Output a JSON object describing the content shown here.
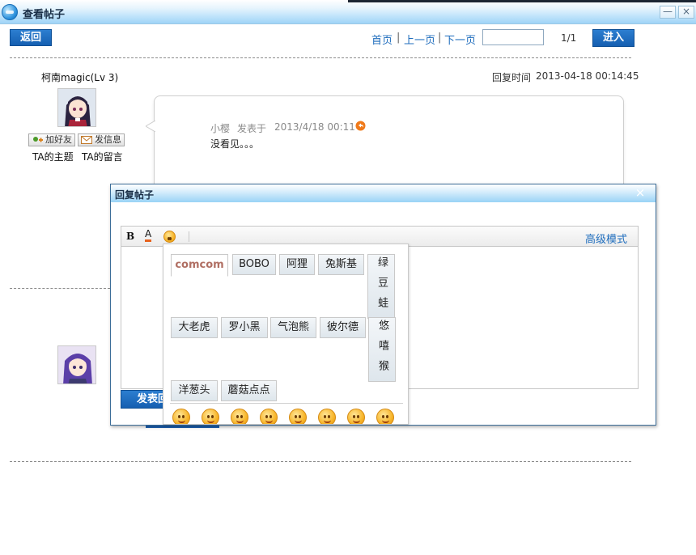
{
  "window": {
    "title": "查看帖子",
    "minimize_label": "—",
    "close_label": "×"
  },
  "toolbar": {
    "back_label": "返回",
    "first_label": "首页",
    "prev_label": "上一页",
    "next_label": "下一页",
    "separator": "|",
    "page_input_value": "",
    "page_counter": "1/1",
    "go_label": "进入"
  },
  "post": {
    "author": "柯南magic(Lv 3)",
    "reply_time_label": "回复时间",
    "reply_time": "2013-04-18 00:14:45",
    "add_friend_label": "加好友",
    "send_message_label": "发信息",
    "topics_link": "TA的主题",
    "messages_link": "TA的留言",
    "quote_author": "小樱",
    "quote_posted_label": "发表于",
    "quote_date": "2013/4/18 00:11",
    "content": "没看见。。。"
  },
  "reply_dialog": {
    "title": "回复帖子",
    "close_label": "×",
    "bold_label": "B",
    "color_label": "A",
    "advanced_mode_label": "高级模式",
    "submit_label": "发表回复"
  },
  "emoticon_panel": {
    "tabs": [
      "comcom",
      "BOBO",
      "阿狸",
      "兔斯基",
      "绿豆蛙",
      "大老虎",
      "罗小黑",
      "气泡熊",
      "彼尔德",
      "悠嘻猴",
      "洋葱头",
      "蘑菇点点"
    ],
    "active_tab": "comcom",
    "faces": [
      "face-1",
      "face-2",
      "face-3",
      "face-4",
      "face-5",
      "face-6",
      "face-7",
      "face-8"
    ]
  },
  "colors": {
    "accent_blue": "#1a66bb",
    "link_blue": "#1f6dbd",
    "active_tab_text": "#b06f63"
  }
}
